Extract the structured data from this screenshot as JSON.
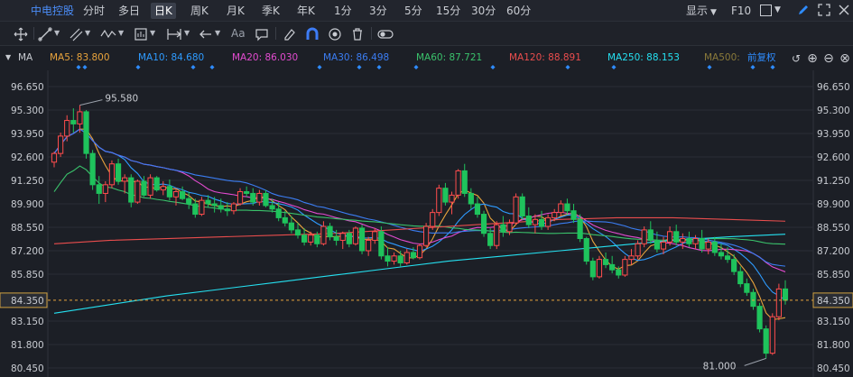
{
  "topbar": {
    "stock_name": "中电控股",
    "tabs": [
      "分时",
      "多日",
      "日K",
      "周K",
      "月K",
      "季K",
      "年K",
      "1分",
      "3分",
      "5分",
      "15分",
      "30分",
      "60分"
    ],
    "active_tab": "日K",
    "display_label": "显示",
    "f10_label": "F10"
  },
  "toolbar": {
    "text_tool_label": "Aa",
    "icons": [
      "move-icon",
      "line-icon",
      "channel-icon",
      "wave-icon",
      "measure-icon",
      "range-icon",
      "arrow-left-icon",
      "text-icon",
      "comment-icon",
      "eraser-icon",
      "magnet-icon",
      "eye-icon",
      "trash-icon",
      "toggle-icon"
    ]
  },
  "indicator": {
    "name": "MA",
    "ma_lines": [
      {
        "label": "MA5: 83.800",
        "color": "#e8a33c"
      },
      {
        "label": "MA10: 84.680",
        "color": "#2e9bff"
      },
      {
        "label": "MA20: 86.030",
        "color": "#e34bd0"
      },
      {
        "label": "MA30: 86.498",
        "color": "#3b7df2"
      },
      {
        "label": "MA60: 87.721",
        "color": "#3ac26b"
      },
      {
        "label": "MA120: 88.891",
        "color": "#ea4d4d"
      },
      {
        "label": "MA250: 88.153",
        "color": "#25e0f0"
      },
      {
        "label": "MA500:",
        "color": "#8a7a3a"
      }
    ],
    "adjust_label": "前复权"
  },
  "chart_data": {
    "type": "candlestick",
    "y_ticks": [
      "96.650",
      "95.300",
      "93.950",
      "92.600",
      "91.250",
      "89.900",
      "88.550",
      "87.200",
      "85.850",
      "84.350",
      "83.150",
      "81.800",
      "80.450"
    ],
    "current_price": "84.350",
    "annotations": [
      "95.580",
      "81.000"
    ],
    "colors": {
      "up": "#ff4d4d",
      "down": "#1fc35c",
      "grid": "#2a2e37",
      "ma5": "#e8a33c",
      "ma10": "#2e9bff",
      "ma20": "#e34bd0",
      "ma30": "#3b7df2",
      "ma60": "#3ac26b",
      "ma120": "#ea4d4d",
      "ma250": "#25e0f0"
    },
    "ylim": [
      80.45,
      96.65
    ],
    "candles": [
      [
        92.3,
        92.9,
        92.0,
        92.8
      ],
      [
        92.8,
        94.0,
        92.6,
        93.8
      ],
      [
        93.8,
        95.0,
        93.5,
        94.7
      ],
      [
        94.7,
        95.4,
        94.0,
        94.5
      ],
      [
        94.5,
        95.58,
        94.0,
        95.2
      ],
      [
        95.2,
        95.3,
        92.5,
        92.8
      ],
      [
        92.8,
        93.0,
        90.7,
        91.0
      ],
      [
        91.0,
        91.5,
        89.9,
        90.5
      ],
      [
        90.5,
        91.2,
        90.0,
        91.0
      ],
      [
        91.0,
        92.4,
        90.8,
        92.2
      ],
      [
        92.2,
        92.5,
        91.0,
        91.2
      ],
      [
        91.2,
        91.6,
        90.5,
        91.4
      ],
      [
        91.4,
        91.6,
        89.7,
        90.0
      ],
      [
        90.0,
        91.3,
        89.9,
        91.2
      ],
      [
        91.2,
        91.5,
        90.3,
        90.4
      ],
      [
        90.4,
        91.6,
        90.2,
        91.4
      ],
      [
        91.4,
        91.5,
        90.6,
        90.7
      ],
      [
        90.7,
        91.2,
        90.4,
        90.9
      ],
      [
        90.9,
        91.3,
        90.1,
        90.3
      ],
      [
        90.3,
        90.8,
        89.8,
        90.6
      ],
      [
        90.6,
        90.9,
        90.1,
        90.2
      ],
      [
        90.2,
        90.6,
        89.6,
        89.9
      ],
      [
        89.9,
        90.2,
        89.1,
        89.3
      ],
      [
        89.3,
        90.3,
        89.2,
        90.1
      ],
      [
        90.1,
        90.4,
        89.7,
        89.9
      ],
      [
        89.9,
        90.3,
        89.4,
        89.8
      ],
      [
        89.8,
        90.2,
        89.4,
        89.6
      ],
      [
        89.6,
        90.0,
        89.2,
        89.5
      ],
      [
        89.5,
        90.0,
        89.3,
        89.9
      ],
      [
        89.9,
        90.8,
        89.8,
        90.6
      ],
      [
        90.6,
        90.9,
        90.3,
        90.5
      ],
      [
        90.5,
        90.8,
        89.8,
        90.0
      ],
      [
        90.0,
        90.7,
        89.8,
        90.5
      ],
      [
        90.5,
        90.7,
        89.7,
        89.8
      ],
      [
        89.8,
        90.2,
        89.4,
        89.6
      ],
      [
        89.6,
        90.0,
        88.9,
        89.1
      ],
      [
        89.1,
        89.5,
        88.6,
        88.8
      ],
      [
        88.8,
        89.2,
        88.2,
        88.4
      ],
      [
        88.4,
        88.8,
        87.9,
        88.1
      ],
      [
        88.1,
        88.5,
        87.5,
        87.7
      ],
      [
        87.7,
        88.3,
        87.5,
        88.1
      ],
      [
        88.1,
        88.3,
        87.4,
        87.6
      ],
      [
        87.6,
        88.9,
        87.5,
        88.6
      ],
      [
        88.6,
        88.8,
        87.8,
        88.0
      ],
      [
        88.0,
        88.4,
        87.5,
        87.8
      ],
      [
        87.8,
        88.3,
        87.3,
        88.2
      ],
      [
        88.2,
        88.4,
        87.4,
        87.6
      ],
      [
        87.6,
        88.6,
        87.5,
        88.5
      ],
      [
        88.5,
        88.7,
        87.0,
        87.2
      ],
      [
        87.2,
        88.0,
        86.9,
        87.8
      ],
      [
        87.8,
        88.5,
        87.6,
        88.3
      ],
      [
        88.3,
        88.6,
        86.7,
        86.9
      ],
      [
        86.9,
        87.4,
        86.3,
        86.6
      ],
      [
        86.6,
        87.1,
        86.4,
        86.9
      ],
      [
        86.9,
        87.2,
        86.3,
        86.5
      ],
      [
        86.5,
        87.3,
        86.4,
        87.1
      ],
      [
        87.1,
        87.4,
        86.7,
        86.8
      ],
      [
        86.8,
        87.6,
        86.7,
        87.5
      ],
      [
        87.5,
        88.8,
        87.4,
        88.6
      ],
      [
        88.6,
        89.6,
        88.4,
        89.4
      ],
      [
        89.4,
        91.0,
        89.2,
        90.8
      ],
      [
        90.8,
        91.1,
        89.8,
        90.0
      ],
      [
        90.0,
        90.6,
        89.3,
        90.4
      ],
      [
        90.4,
        91.9,
        90.2,
        91.8
      ],
      [
        91.8,
        92.2,
        90.3,
        90.5
      ],
      [
        90.5,
        90.8,
        89.6,
        89.9
      ],
      [
        89.9,
        90.3,
        89.1,
        89.3
      ],
      [
        89.3,
        89.5,
        88.0,
        88.2
      ],
      [
        88.2,
        88.5,
        87.3,
        87.5
      ],
      [
        87.5,
        88.9,
        87.3,
        88.7
      ],
      [
        88.7,
        89.2,
        88.0,
        88.3
      ],
      [
        88.3,
        89.0,
        88.1,
        88.8
      ],
      [
        88.8,
        90.5,
        88.7,
        90.3
      ],
      [
        90.3,
        90.5,
        89.0,
        89.2
      ],
      [
        89.2,
        89.7,
        88.5,
        88.7
      ],
      [
        88.7,
        89.3,
        88.2,
        89.0
      ],
      [
        89.0,
        89.5,
        88.4,
        88.6
      ],
      [
        88.6,
        89.3,
        88.4,
        89.1
      ],
      [
        89.1,
        89.6,
        88.9,
        89.4
      ],
      [
        89.4,
        90.1,
        89.2,
        89.9
      ],
      [
        89.9,
        90.2,
        89.3,
        89.5
      ],
      [
        89.5,
        89.9,
        88.8,
        89.0
      ],
      [
        89.0,
        89.3,
        87.7,
        87.9
      ],
      [
        87.9,
        88.0,
        86.4,
        86.6
      ],
      [
        86.6,
        86.8,
        85.5,
        85.7
      ],
      [
        85.7,
        86.9,
        85.6,
        86.7
      ],
      [
        86.7,
        87.1,
        86.2,
        86.4
      ],
      [
        86.4,
        86.9,
        85.9,
        86.1
      ],
      [
        86.1,
        86.3,
        85.6,
        85.8
      ],
      [
        85.8,
        86.9,
        85.7,
        86.7
      ],
      [
        86.7,
        87.3,
        86.4,
        86.9
      ],
      [
        86.9,
        87.8,
        86.7,
        87.6
      ],
      [
        87.6,
        88.6,
        87.4,
        88.4
      ],
      [
        88.4,
        88.9,
        87.6,
        87.8
      ],
      [
        87.8,
        88.3,
        87.1,
        87.3
      ],
      [
        87.3,
        88.0,
        87.0,
        87.7
      ],
      [
        87.7,
        88.6,
        87.5,
        88.3
      ],
      [
        88.3,
        88.7,
        87.5,
        87.7
      ],
      [
        87.7,
        88.2,
        87.3,
        87.9
      ],
      [
        87.9,
        88.3,
        87.4,
        87.6
      ],
      [
        87.6,
        88.1,
        87.3,
        87.9
      ],
      [
        87.9,
        88.4,
        87.1,
        87.3
      ],
      [
        87.3,
        87.9,
        87.0,
        87.7
      ],
      [
        87.7,
        88.0,
        86.9,
        87.1
      ],
      [
        87.1,
        87.6,
        86.7,
        86.9
      ],
      [
        86.9,
        87.4,
        86.5,
        86.7
      ],
      [
        86.7,
        87.0,
        85.8,
        86.0
      ],
      [
        86.0,
        86.3,
        85.1,
        85.3
      ],
      [
        85.3,
        85.6,
        84.6,
        84.8
      ],
      [
        84.8,
        85.0,
        83.8,
        84.0
      ],
      [
        84.0,
        84.2,
        82.5,
        82.7
      ],
      [
        82.7,
        82.9,
        81.0,
        81.3
      ],
      [
        81.3,
        83.6,
        81.2,
        83.4
      ],
      [
        83.4,
        85.3,
        83.2,
        85.0
      ],
      [
        85.0,
        85.5,
        84.1,
        84.35
      ]
    ]
  }
}
